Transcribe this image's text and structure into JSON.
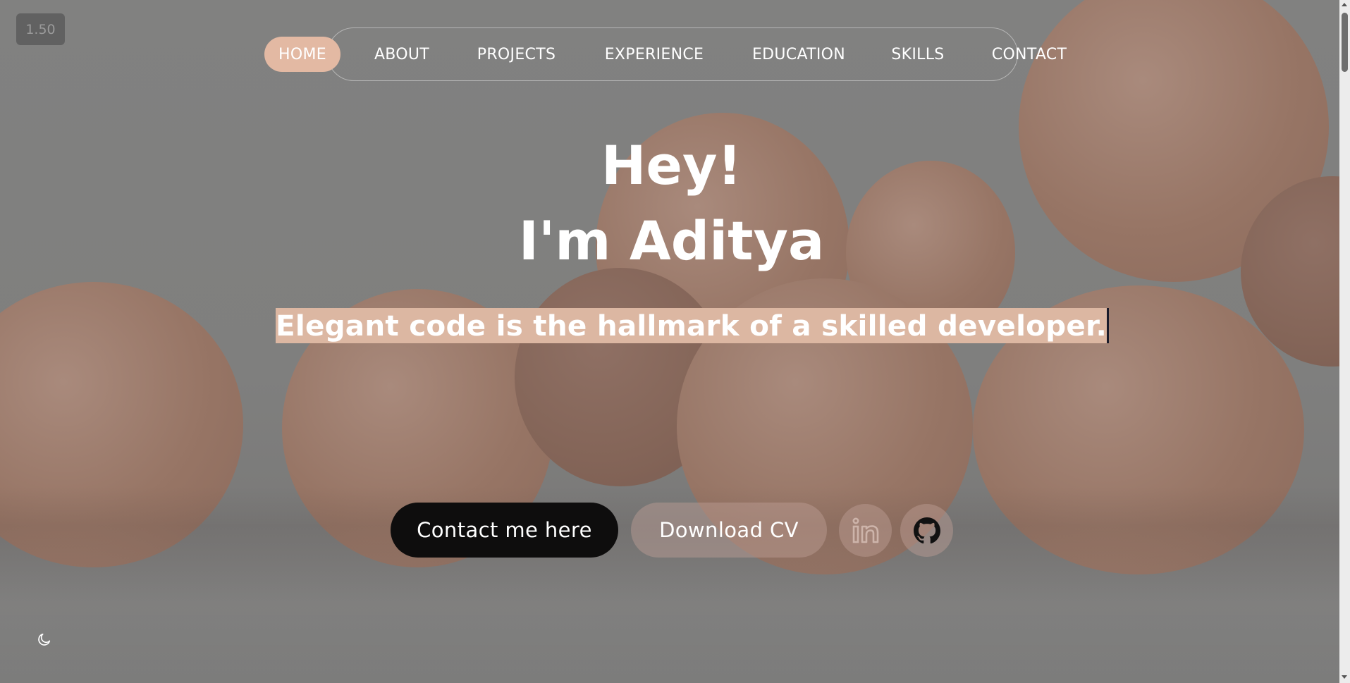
{
  "version_badge": "1.50",
  "nav": {
    "items": [
      {
        "label": "HOME",
        "active": true
      },
      {
        "label": "ABOUT",
        "active": false
      },
      {
        "label": "PROJECTS",
        "active": false
      },
      {
        "label": "EXPERIENCE",
        "active": false
      },
      {
        "label": "EDUCATION",
        "active": false
      },
      {
        "label": "SKILLS",
        "active": false
      },
      {
        "label": "CONTACT",
        "active": false
      }
    ]
  },
  "hero": {
    "greeting": "Hey!",
    "name_line": "I'm Aditya",
    "tagline": "Elegant code is the hallmark of a skilled developer."
  },
  "actions": {
    "contact_label": "Contact me here",
    "download_label": "Download CV",
    "linkedin_icon": "linkedin-icon",
    "github_icon": "github-icon"
  },
  "theme_toggle_icon": "moon-icon",
  "colors": {
    "accent": "#e3b9a3",
    "tagline_highlight": "#dcb7a2",
    "dark_button": "#0e0d0d"
  }
}
